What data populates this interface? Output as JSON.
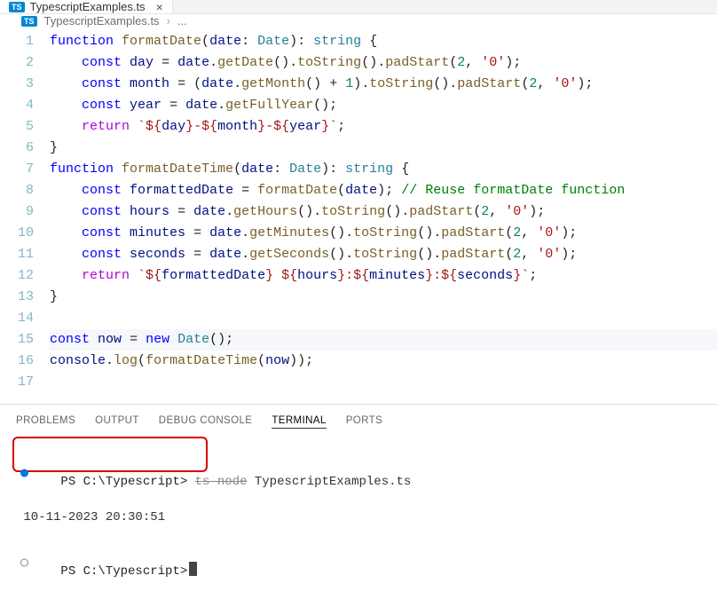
{
  "tab": {
    "filename": "TypescriptExamples.ts",
    "badge": "TS",
    "close": "×"
  },
  "breadcrumb": {
    "badge": "TS",
    "filename": "TypescriptExamples.ts",
    "sep": "›",
    "trailing": "..."
  },
  "editor": {
    "lines": [
      1,
      2,
      3,
      4,
      5,
      6,
      7,
      8,
      9,
      10,
      11,
      12,
      13,
      14,
      15,
      16,
      17
    ]
  },
  "panel": {
    "tabs": {
      "problems": "PROBLEMS",
      "output": "OUTPUT",
      "debug": "DEBUG CONSOLE",
      "terminal": "TERMINAL",
      "ports": "PORTS"
    }
  },
  "terminal": {
    "line1_prompt": "PS C:\\Typescript>",
    "line1_struck": "ts-node",
    "line1_rest": " TypescriptExamples.ts",
    "line2_output": "10-11-2023 20:30:51",
    "line3_prompt": "PS C:\\Typescript>"
  }
}
